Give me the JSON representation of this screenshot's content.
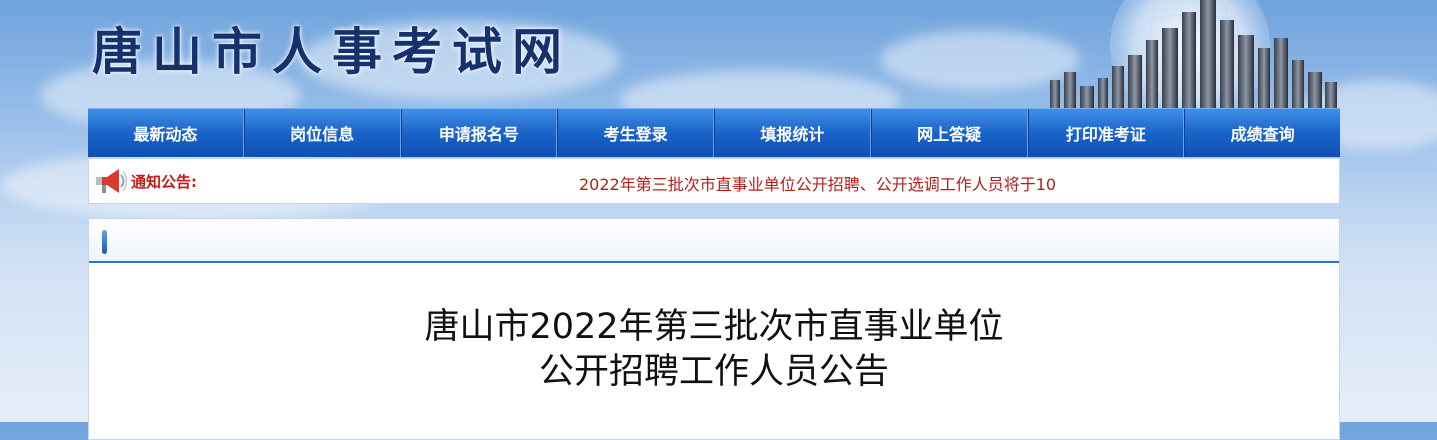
{
  "site": {
    "title": "唐山市人事考试网"
  },
  "nav": {
    "items": [
      {
        "label": "最新动态"
      },
      {
        "label": "岗位信息"
      },
      {
        "label": "申请报名号"
      },
      {
        "label": "考生登录"
      },
      {
        "label": "填报统计"
      },
      {
        "label": "网上答疑"
      },
      {
        "label": "打印准考证"
      },
      {
        "label": "成绩查询"
      }
    ]
  },
  "notice": {
    "label": "通知公告:",
    "text": "2022年第三批次市直事业单位公开招聘、公开选调工作人员将于10",
    "icon": "megaphone-icon",
    "color": "#b0211c"
  },
  "article": {
    "title_line1": "唐山市2022年第三批次市直事业单位",
    "title_line2": "公开招聘工作人员公告"
  },
  "colors": {
    "nav_bg": "#1a64c9",
    "title": "#16326e",
    "accent": "#2f72c8"
  }
}
